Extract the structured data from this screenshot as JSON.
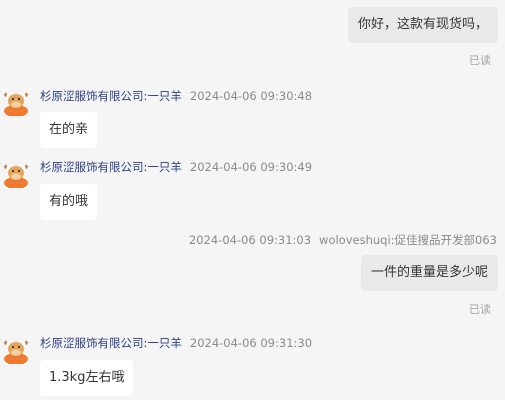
{
  "messages": [
    {
      "direction": "out",
      "text": "你好，这款有现货吗，",
      "status": "已读"
    },
    {
      "direction": "in",
      "sender": "杉原涩服饰有限公司:一只羊",
      "time": "2024-04-06 09:30:48",
      "text": "在的亲"
    },
    {
      "direction": "in",
      "sender": "杉原涩服饰有限公司:一只羊",
      "time": "2024-04-06 09:30:49",
      "text": "有的哦"
    },
    {
      "direction": "out",
      "sender": "woloveshuqi:促佳搜品开发部063",
      "time": "2024-04-06 09:31:03",
      "text": "一件的重量是多少呢",
      "status": "已读"
    },
    {
      "direction": "in",
      "sender": "杉原涩服饰有限公司:一只羊",
      "time": "2024-04-06 09:31:30",
      "text": "1.3kg左右哦"
    }
  ],
  "avatar_icon": "cow-avatar-icon",
  "colors": {
    "background": "#f5f5f5",
    "outgoing_bubble": "#e9e9e9",
    "incoming_bubble": "#ffffff",
    "sender_name": "#2b3f88",
    "avatar": "#f07a2f"
  }
}
